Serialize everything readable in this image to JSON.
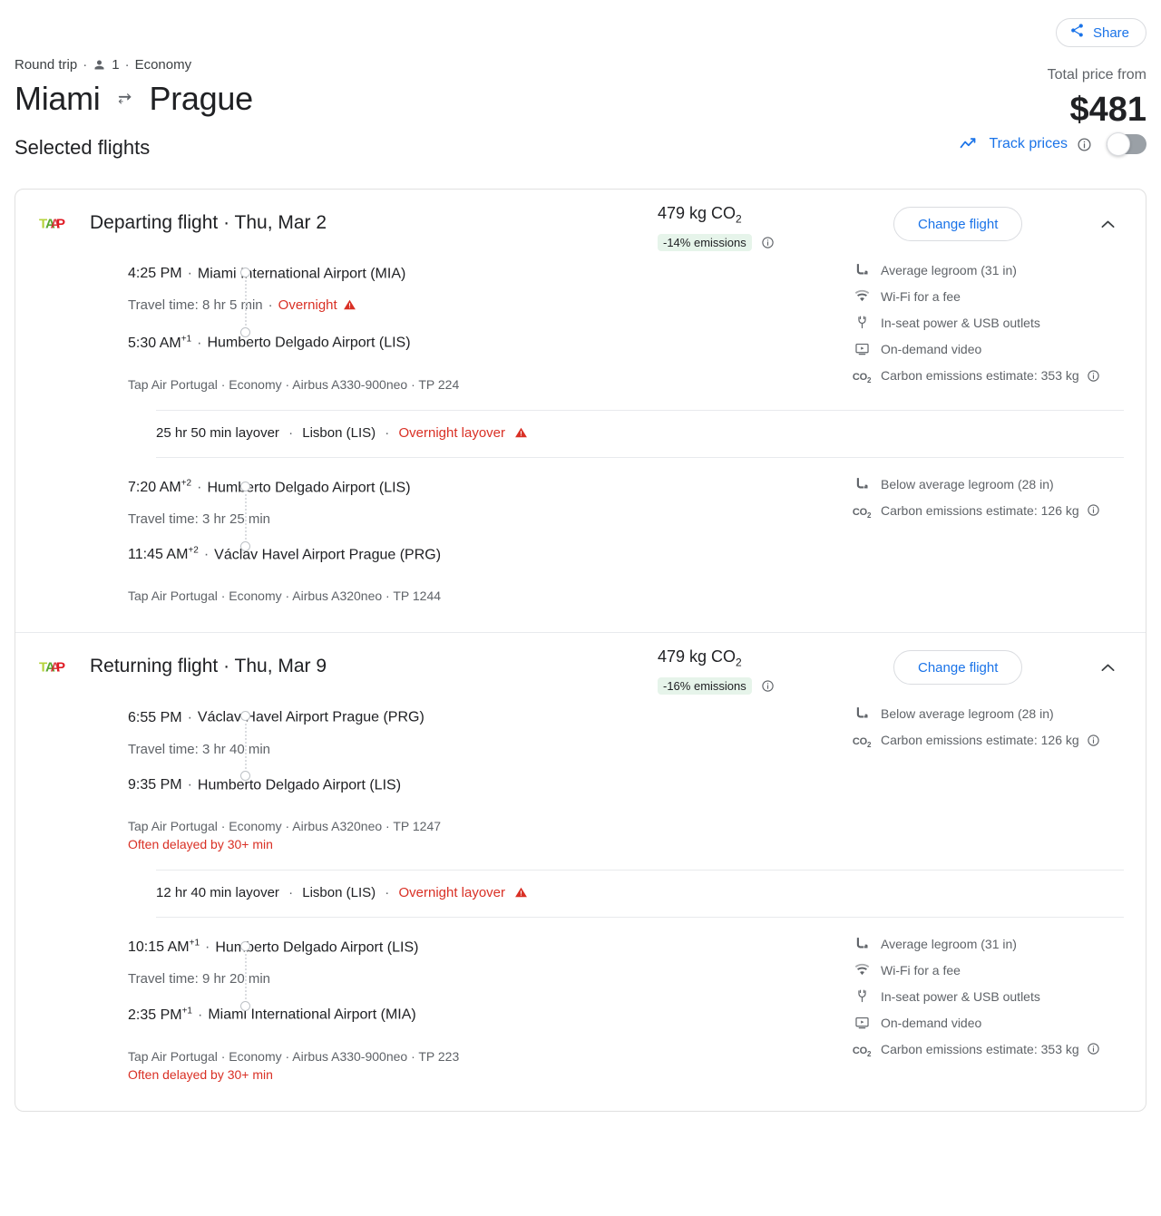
{
  "header": {
    "share_label": "Share",
    "trip_type": "Round trip",
    "passengers": "1",
    "cabin": "Economy",
    "dot": "·",
    "origin": "Miami",
    "destination": "Prague",
    "total_label": "Total price from",
    "total_price": "$481"
  },
  "selected": {
    "title": "Selected flights",
    "track_label": "Track prices",
    "toggle_state": "off"
  },
  "flights": [
    {
      "title": "Departing flight · Thu, Mar 2",
      "airline_logo": "tap-air-portugal-logo",
      "emissions": "479 kg CO",
      "emissions_sub": "2",
      "emissions_badge": "-14% emissions",
      "change_flight_label": "Change flight",
      "segments": [
        {
          "depart_time": "4:25 PM",
          "depart_day_offset": "",
          "depart_airport": "Miami International Airport (MIA)",
          "travel_time": "Travel time: 8 hr 5 min",
          "travel_warning": "Overnight",
          "arrive_time": "5:30 AM",
          "arrive_day_offset": "+1",
          "arrive_airport": "Humberto Delgado Airport (LIS)",
          "meta": "Tap Air Portugal · Economy · Airbus A330-900neo · TP 224",
          "delay_note": "",
          "amenities": [
            {
              "icon": "legroom-icon",
              "text": "Average legroom (31 in)",
              "info": false
            },
            {
              "icon": "wifi-icon",
              "text": "Wi-Fi for a fee",
              "info": false
            },
            {
              "icon": "power-outlet-icon",
              "text": "In-seat power & USB outlets",
              "info": false
            },
            {
              "icon": "video-icon",
              "text": "On-demand video",
              "info": false
            },
            {
              "icon": "co2-icon",
              "text": "Carbon emissions estimate: 353 kg",
              "info": true
            }
          ]
        },
        {
          "depart_time": "7:20 AM",
          "depart_day_offset": "+2",
          "depart_airport": "Humberto Delgado Airport (LIS)",
          "travel_time": "Travel time: 3 hr 25 min",
          "travel_warning": "",
          "arrive_time": "11:45 AM",
          "arrive_day_offset": "+2",
          "arrive_airport": "Václav Havel Airport Prague (PRG)",
          "meta": "Tap Air Portugal · Economy · Airbus A320neo · TP 1244",
          "delay_note": "",
          "amenities": [
            {
              "icon": "legroom-below-icon",
              "text": "Below average legroom (28 in)",
              "info": false
            },
            {
              "icon": "co2-icon",
              "text": "Carbon emissions estimate: 126 kg",
              "info": true
            }
          ]
        }
      ],
      "layover": {
        "duration": "25 hr 50 min layover",
        "city": "Lisbon (LIS)",
        "warning": "Overnight layover"
      }
    },
    {
      "title": "Returning flight · Thu, Mar 9",
      "airline_logo": "tap-air-portugal-logo",
      "emissions": "479 kg CO",
      "emissions_sub": "2",
      "emissions_badge": "-16% emissions",
      "change_flight_label": "Change flight",
      "segments": [
        {
          "depart_time": "6:55 PM",
          "depart_day_offset": "",
          "depart_airport": "Václav Havel Airport Prague (PRG)",
          "travel_time": "Travel time: 3 hr 40 min",
          "travel_warning": "",
          "arrive_time": "9:35 PM",
          "arrive_day_offset": "",
          "arrive_airport": "Humberto Delgado Airport (LIS)",
          "meta": "Tap Air Portugal · Economy · Airbus A320neo · TP 1247",
          "delay_note": "Often delayed by 30+ min",
          "amenities": [
            {
              "icon": "legroom-below-icon",
              "text": "Below average legroom (28 in)",
              "info": false
            },
            {
              "icon": "co2-icon",
              "text": "Carbon emissions estimate: 126 kg",
              "info": true
            }
          ]
        },
        {
          "depart_time": "10:15 AM",
          "depart_day_offset": "+1",
          "depart_airport": "Humberto Delgado Airport (LIS)",
          "travel_time": "Travel time: 9 hr 20 min",
          "travel_warning": "",
          "arrive_time": "2:35 PM",
          "arrive_day_offset": "+1",
          "arrive_airport": "Miami International Airport (MIA)",
          "meta": "Tap Air Portugal · Economy · Airbus A330-900neo · TP 223",
          "delay_note": "Often delayed by 30+ min",
          "amenities": [
            {
              "icon": "legroom-icon",
              "text": "Average legroom (31 in)",
              "info": false
            },
            {
              "icon": "wifi-icon",
              "text": "Wi-Fi for a fee",
              "info": false
            },
            {
              "icon": "power-outlet-icon",
              "text": "In-seat power & USB outlets",
              "info": false
            },
            {
              "icon": "video-icon",
              "text": "On-demand video",
              "info": false
            },
            {
              "icon": "co2-icon",
              "text": "Carbon emissions estimate: 353 kg",
              "info": true
            }
          ]
        }
      ],
      "layover": {
        "duration": "12 hr 40 min layover",
        "city": "Lisbon (LIS)",
        "warning": "Overnight layover"
      }
    }
  ],
  "colors": {
    "accent_blue": "#1a73e8",
    "warning_red": "#d93025",
    "badge_green_bg": "#e6f4ea",
    "text_primary": "#202124",
    "text_secondary": "#5f6368"
  }
}
